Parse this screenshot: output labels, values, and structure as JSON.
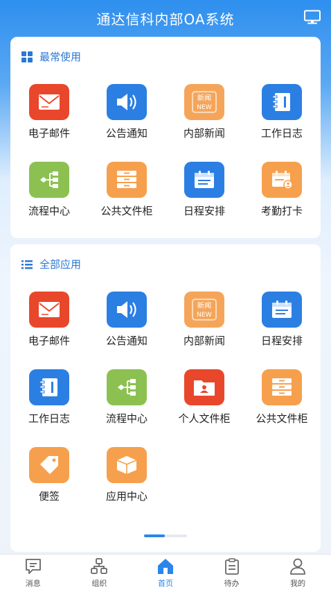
{
  "header": {
    "title": "通达信科内部OA系统",
    "right_icon": "monitor-icon"
  },
  "frequent": {
    "heading": "最常使用",
    "apps": [
      {
        "label": "电子邮件",
        "icon": "mail-icon",
        "color": "#e9472b"
      },
      {
        "label": "公告通知",
        "icon": "speaker-icon",
        "color": "#2b7fe3"
      },
      {
        "label": "内部新闻",
        "icon": "news-icon",
        "color": "#f5a55a"
      },
      {
        "label": "工作日志",
        "icon": "notebook-icon",
        "color": "#2b7fe3"
      },
      {
        "label": "流程中心",
        "icon": "flow-icon",
        "color": "#8cc152"
      },
      {
        "label": "公共文件柜",
        "icon": "cabinet-icon",
        "color": "#f6a04d"
      },
      {
        "label": "日程安排",
        "icon": "calendar-icon",
        "color": "#2b7fe3"
      },
      {
        "label": "考勤打卡",
        "icon": "attendance-icon",
        "color": "#f6a04d"
      }
    ]
  },
  "all_apps": {
    "heading": "全部应用",
    "apps": [
      {
        "label": "电子邮件",
        "icon": "mail-icon",
        "color": "#e9472b"
      },
      {
        "label": "公告通知",
        "icon": "speaker-icon",
        "color": "#2b7fe3"
      },
      {
        "label": "内部新闻",
        "icon": "news-icon",
        "color": "#f5a55a"
      },
      {
        "label": "日程安排",
        "icon": "calendar-icon",
        "color": "#2b7fe3"
      },
      {
        "label": "工作日志",
        "icon": "notebook-icon",
        "color": "#2b7fe3"
      },
      {
        "label": "流程中心",
        "icon": "flow-icon",
        "color": "#8cc152"
      },
      {
        "label": "个人文件柜",
        "icon": "personal-folder-icon",
        "color": "#e9472b"
      },
      {
        "label": "公共文件柜",
        "icon": "cabinet-icon",
        "color": "#f6a04d"
      },
      {
        "label": "便签",
        "icon": "tag-icon",
        "color": "#f6a04d"
      },
      {
        "label": "应用中心",
        "icon": "box-icon",
        "color": "#f6a04d"
      }
    ]
  },
  "news_icon_text": {
    "line1": "新闻",
    "line2": "NEW"
  },
  "tabbar": {
    "tabs": [
      {
        "label": "消息",
        "icon": "message-icon"
      },
      {
        "label": "组织",
        "icon": "org-icon"
      },
      {
        "label": "首页",
        "icon": "home-icon",
        "active": true
      },
      {
        "label": "待办",
        "icon": "clipboard-icon"
      },
      {
        "label": "我的",
        "icon": "user-icon"
      }
    ]
  },
  "colors": {
    "accent": "#2a86ea",
    "heading": "#2a78d6"
  }
}
